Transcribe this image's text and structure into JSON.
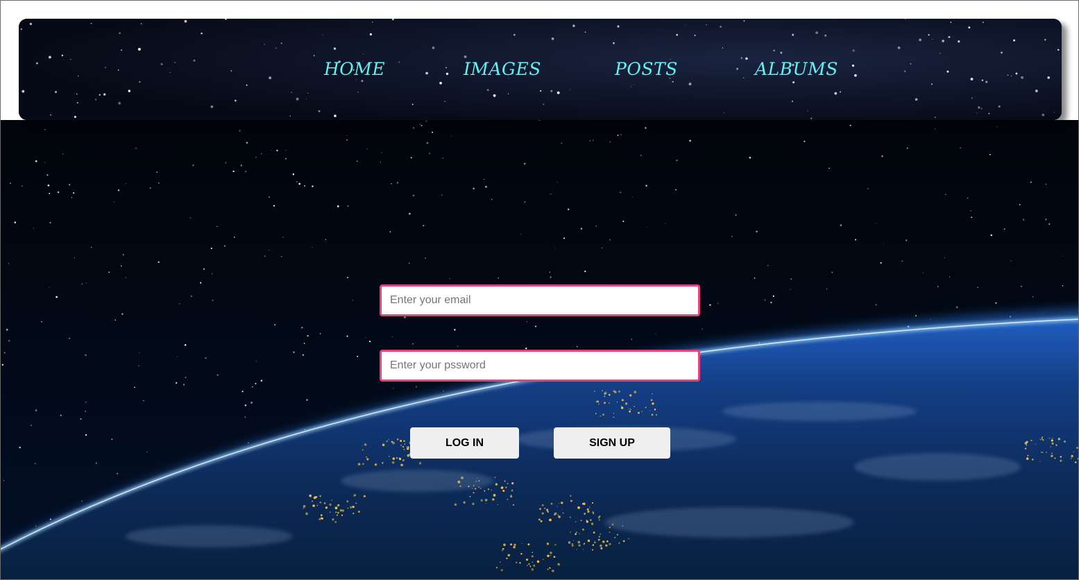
{
  "nav": {
    "items": [
      {
        "label": "HOME"
      },
      {
        "label": "IMAGES"
      },
      {
        "label": "POSTS"
      },
      {
        "label": "ALBUMS"
      }
    ],
    "link_color": "#5ff3f3"
  },
  "form": {
    "email": {
      "placeholder": "Enter your email",
      "value": ""
    },
    "password": {
      "placeholder": "Enter your pssword",
      "value": ""
    },
    "login_label": "LOG IN",
    "signup_label": "SIGN UP",
    "input_border_color": "#e8417c"
  },
  "background": {
    "description_icon": "earth-from-space-image"
  }
}
